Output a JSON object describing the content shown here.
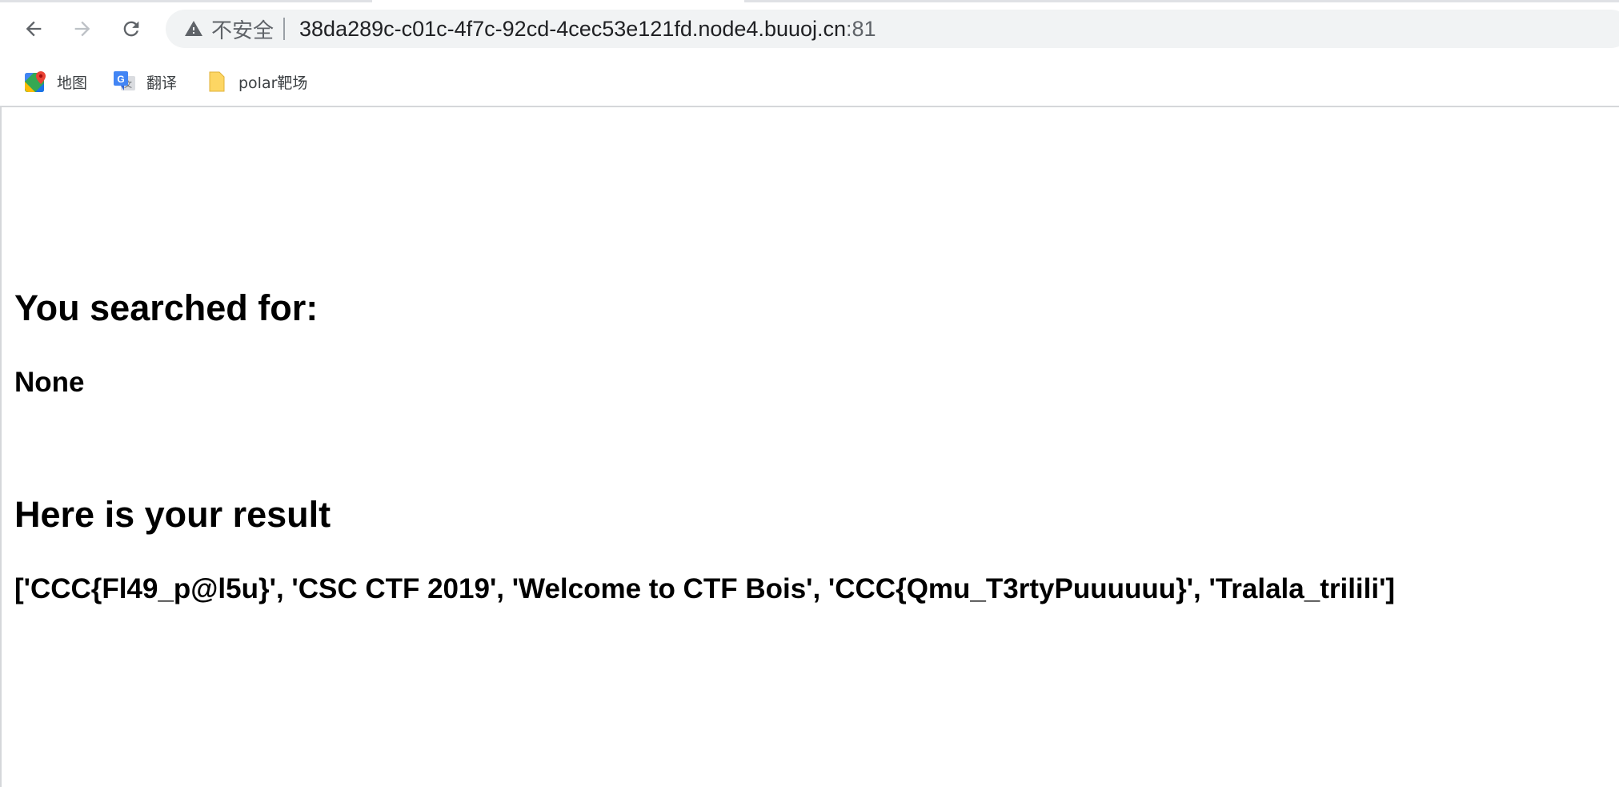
{
  "browser": {
    "nav": {
      "back_icon": "arrow-left-icon",
      "forward_icon": "arrow-right-icon",
      "reload_icon": "reload-icon"
    },
    "omnibox": {
      "security_icon": "warning-triangle-icon",
      "security_label": "不安全",
      "url_host": "38da289c-c01c-4f7c-92cd-4cec53e121fd.node4.buuoj.cn",
      "url_port": ":81"
    },
    "bookmarks": [
      {
        "label": "地图",
        "icon": "google-maps-icon"
      },
      {
        "label": "翻译",
        "icon": "google-translate-icon"
      },
      {
        "label": "polar靶场",
        "icon": "folder-icon"
      }
    ]
  },
  "page": {
    "searched_heading": "You searched for:",
    "query_value": "None",
    "result_heading": "Here is your result",
    "result_value": "['CCC{Fl49_p@l5u}', 'CSC CTF 2019', 'Welcome to CTF Bois', 'CCC{Qmu_T3rtyPuuuuuu}', 'Tralala_trilili']"
  },
  "colors": {
    "omnibox_bg": "#f1f3f4",
    "secondary_text": "#5f6368",
    "page_text": "#000000",
    "maps_green": "#34a853",
    "maps_red": "#ea4335",
    "translate_blue": "#4285f4",
    "folder_yellow": "#fdd663"
  }
}
